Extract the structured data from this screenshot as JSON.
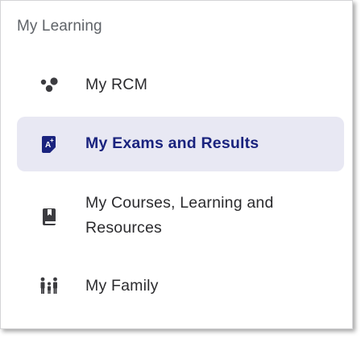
{
  "section": {
    "title": "My Learning"
  },
  "nav": {
    "items": [
      {
        "label": "My RCM",
        "icon": "rcm-dots-icon",
        "active": false
      },
      {
        "label": "My Exams and Results",
        "icon": "exam-grade-icon",
        "active": true
      },
      {
        "label": "My Courses, Learning and Resources",
        "icon": "book-icon",
        "active": false
      },
      {
        "label": "My Family",
        "icon": "family-icon",
        "active": false
      }
    ]
  },
  "colors": {
    "active_background": "#e8e8f3",
    "active_text": "#1a237e",
    "icon_active": "#1a237e",
    "icon_default": "#3c3c40"
  }
}
